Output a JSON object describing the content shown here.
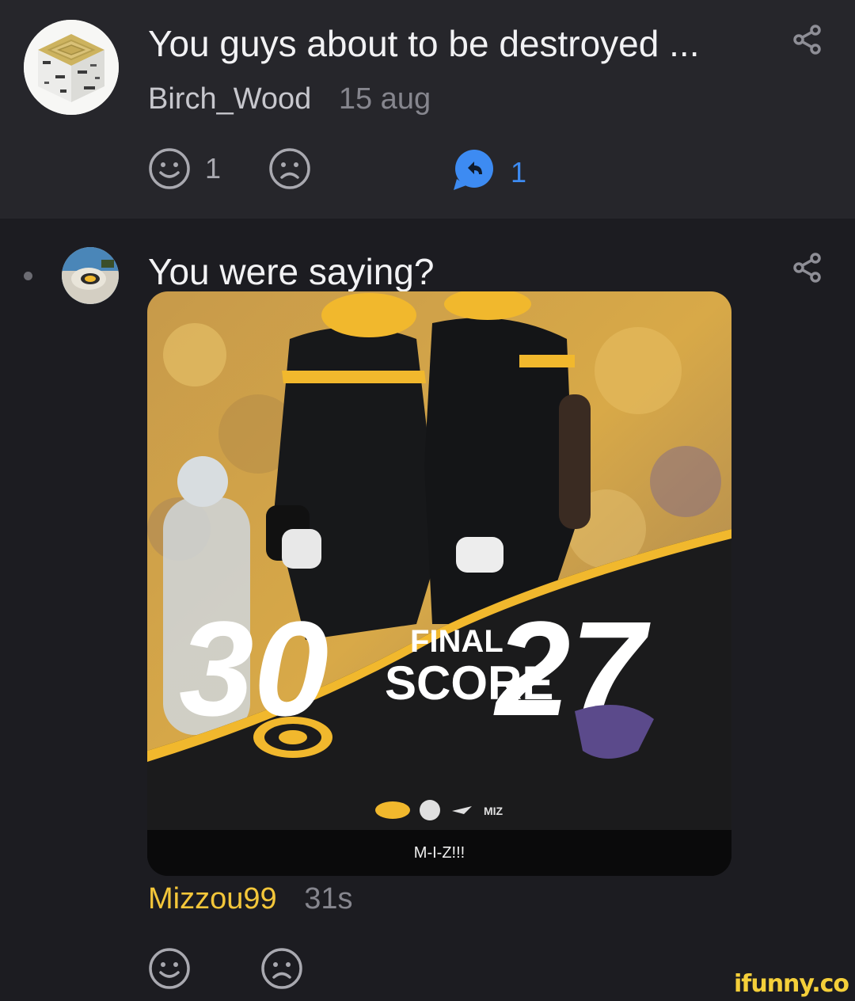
{
  "comment1": {
    "text": "You guys about to be destroyed ...",
    "username": "Birch_Wood",
    "time": "15 aug",
    "likes": "1",
    "replies": "1",
    "avatar_icon": "minecraft-birch-block-icon"
  },
  "comment2": {
    "text": "You were saying?",
    "username": "Mizzou99",
    "time": "31s",
    "avatar_icon": "mizzou-tiger-avatar",
    "image": {
      "score_left": "30",
      "score_right": "27",
      "final_label": "FINAL",
      "score_label": "SCORE",
      "caption": "M-I-Z!!!"
    }
  },
  "watermark": "ifunny.co",
  "colors": {
    "top_bg": "#26262b",
    "bottom_bg": "#1c1c21",
    "reply_blue": "#3d8bf2",
    "username_gold": "#f3c63a",
    "mizzou_gold": "#f1b82d"
  }
}
